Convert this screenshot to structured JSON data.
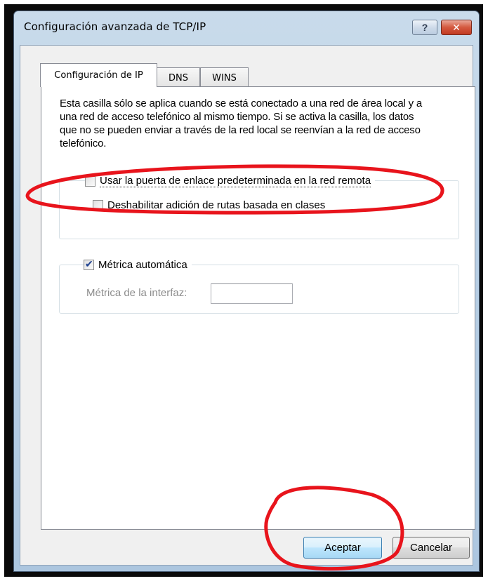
{
  "window": {
    "title": "Configuración avanzada de TCP/IP",
    "help_glyph": "?",
    "close_glyph": "✕"
  },
  "tabs": [
    {
      "label": "Configuración de IP",
      "active": true
    },
    {
      "label": "DNS",
      "active": false
    },
    {
      "label": "WINS",
      "active": false
    }
  ],
  "description": "Esta casilla sólo se aplica cuando se está conectado a una red de área local y a una red de acceso telefónico al mismo tiempo. Si se activa la casilla, los datos que no se pueden enviar a través de la red local se reenvían a la red de acceso telefónico.",
  "options": {
    "use_default_gateway": {
      "label": "Usar la puerta de enlace predeterminada en la red remota",
      "checked": false
    },
    "disable_class_routes": {
      "label": "Deshabilitar adición de rutas basada en clases",
      "checked": false
    },
    "automatic_metric": {
      "label": "Métrica automática",
      "checked": true
    }
  },
  "interface_metric": {
    "label": "Métrica de la interfaz:",
    "value": "",
    "enabled": false
  },
  "buttons": {
    "ok": "Aceptar",
    "cancel": "Cancelar"
  },
  "colors": {
    "annotation": "#e8141c",
    "window_border": "#4a5f78",
    "ok_button_border": "#3c7fb1"
  }
}
